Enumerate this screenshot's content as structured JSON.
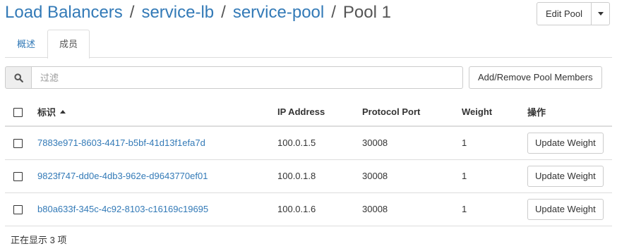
{
  "breadcrumb": {
    "items": [
      "Load Balancers",
      "service-lb",
      "service-pool"
    ],
    "separator": "/",
    "current": "Pool 1"
  },
  "actions": {
    "edit_pool_label": "Edit Pool"
  },
  "tabs": [
    {
      "label": "概述",
      "active": false
    },
    {
      "label": "成员",
      "active": true
    }
  ],
  "filter": {
    "placeholder": "过滤",
    "value": "",
    "pool_members_button": "Add/Remove Pool Members"
  },
  "table": {
    "columns": [
      "标识",
      "IP Address",
      "Protocol Port",
      "Weight",
      "操作"
    ],
    "sort_column": "标识",
    "rows": [
      {
        "id": "7883e971-8603-4417-b5bf-41d13f1efa7d",
        "ip": "100.0.1.5",
        "port": "30008",
        "weight": "1",
        "action": "Update Weight"
      },
      {
        "id": "9823f747-dd0e-4db3-962e-d9643770ef01",
        "ip": "100.0.1.8",
        "port": "30008",
        "weight": "1",
        "action": "Update Weight"
      },
      {
        "id": "b80a633f-345c-4c92-8103-c16169c19695",
        "ip": "100.0.1.6",
        "port": "30008",
        "weight": "1",
        "action": "Update Weight"
      }
    ]
  },
  "footer": {
    "count_text": "正在显示 3 项"
  },
  "colors": {
    "link": "#337ab7",
    "border": "#dddddd"
  }
}
